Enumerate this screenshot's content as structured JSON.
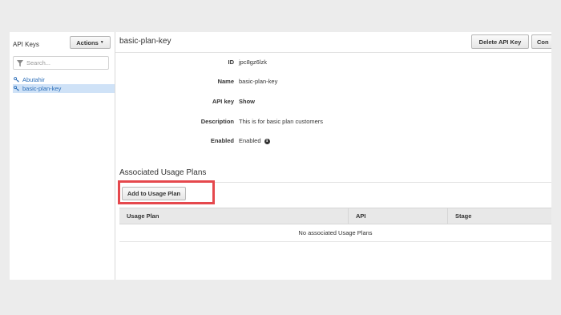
{
  "sidebar": {
    "title": "API Keys",
    "actions_label": "Actions",
    "search_placeholder": "Search...",
    "keys": [
      {
        "label": "Abutahir",
        "selected": false
      },
      {
        "label": "basic-plan-key",
        "selected": true
      }
    ]
  },
  "header": {
    "title": "basic-plan-key",
    "delete_label": "Delete API Key",
    "partial_button_label": "Con"
  },
  "details": {
    "id_label": "ID",
    "id_value": "jpc8gz6lzk",
    "name_label": "Name",
    "name_value": "basic-plan-key",
    "apikey_label": "API key",
    "apikey_value": "Show",
    "description_label": "Description",
    "description_value": "This is for basic plan customers",
    "enabled_label": "Enabled",
    "enabled_value": "Enabled"
  },
  "usage_plans": {
    "section_title": "Associated Usage Plans",
    "add_label": "Add to Usage Plan",
    "columns": [
      "Usage Plan",
      "API",
      "Stage"
    ],
    "empty_message": "No associated Usage Plans"
  },
  "colors": {
    "link": "#2a6db8",
    "selected_bg": "#cfe2f7",
    "highlight": "#e5484d"
  }
}
